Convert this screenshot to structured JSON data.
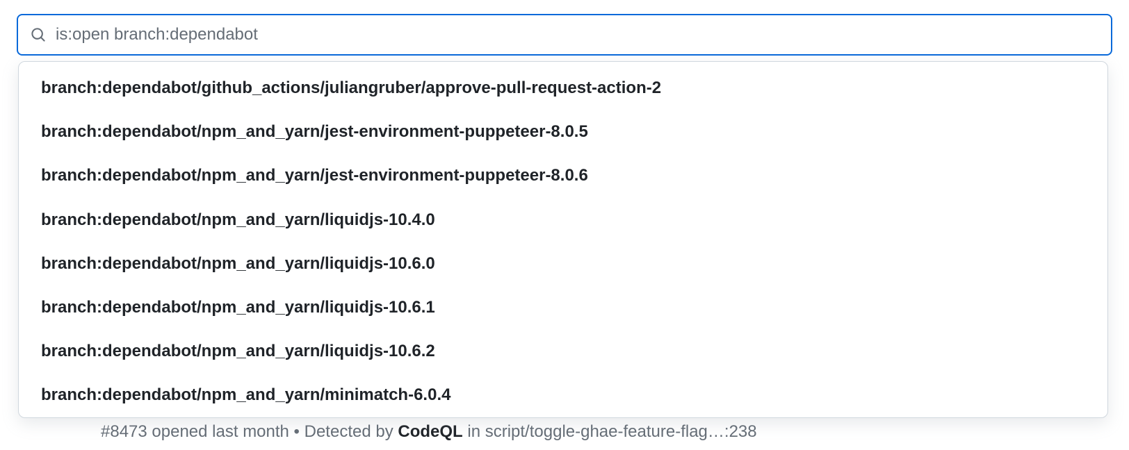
{
  "search": {
    "value": "is:open branch:dependabot"
  },
  "suggestions": [
    {
      "label": "branch:dependabot/github_actions/juliangruber/approve-pull-request-action-2"
    },
    {
      "label": "branch:dependabot/npm_and_yarn/jest-environment-puppeteer-8.0.5"
    },
    {
      "label": "branch:dependabot/npm_and_yarn/jest-environment-puppeteer-8.0.6"
    },
    {
      "label": "branch:dependabot/npm_and_yarn/liquidjs-10.4.0"
    },
    {
      "label": "branch:dependabot/npm_and_yarn/liquidjs-10.6.0"
    },
    {
      "label": "branch:dependabot/npm_and_yarn/liquidjs-10.6.1"
    },
    {
      "label": "branch:dependabot/npm_and_yarn/liquidjs-10.6.2"
    },
    {
      "label": "branch:dependabot/npm_and_yarn/minimatch-6.0.4"
    }
  ],
  "background_row": {
    "id_prefix": "#8473",
    "opened_text": " opened last month • Detected by ",
    "detector": "CodeQL",
    "tail": " in script/toggle-ghae-feature-flag…:238"
  }
}
